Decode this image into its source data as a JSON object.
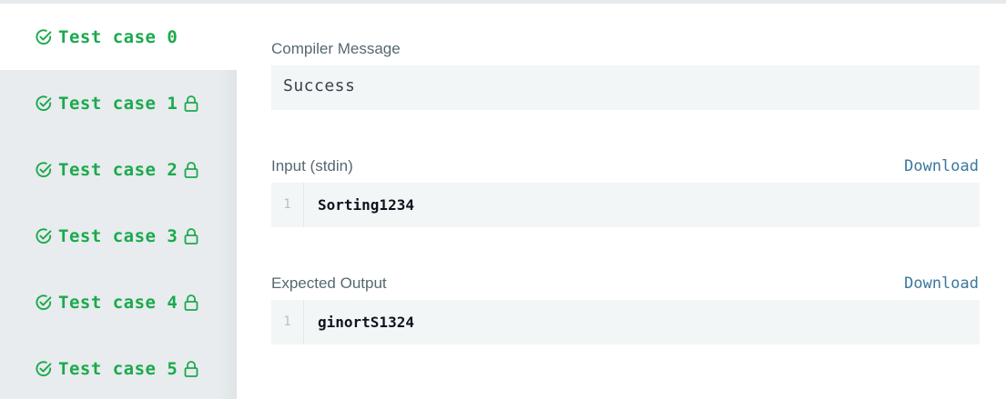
{
  "sidebar": {
    "tabs": [
      {
        "label": "Test case 0",
        "locked": false,
        "active": true
      },
      {
        "label": "Test case 1",
        "locked": true,
        "active": false
      },
      {
        "label": "Test case 2",
        "locked": true,
        "active": false
      },
      {
        "label": "Test case 3",
        "locked": true,
        "active": false
      },
      {
        "label": "Test case 4",
        "locked": true,
        "active": false
      },
      {
        "label": "Test case 5",
        "locked": true,
        "active": false
      }
    ]
  },
  "compiler": {
    "label": "Compiler Message",
    "message": "Success"
  },
  "input": {
    "label": "Input (stdin)",
    "download_label": "Download",
    "line_number": "1",
    "content": "Sorting1234"
  },
  "expected": {
    "label": "Expected Output",
    "download_label": "Download",
    "line_number": "1",
    "content": "ginortS1324"
  },
  "colors": {
    "success_green": "#1ba94c",
    "link_blue": "#39789d",
    "sidebar_bg": "#e8ecee",
    "box_bg": "#f3f6f6"
  },
  "icons": {
    "check": "check-circle-icon",
    "lock": "lock-icon"
  }
}
